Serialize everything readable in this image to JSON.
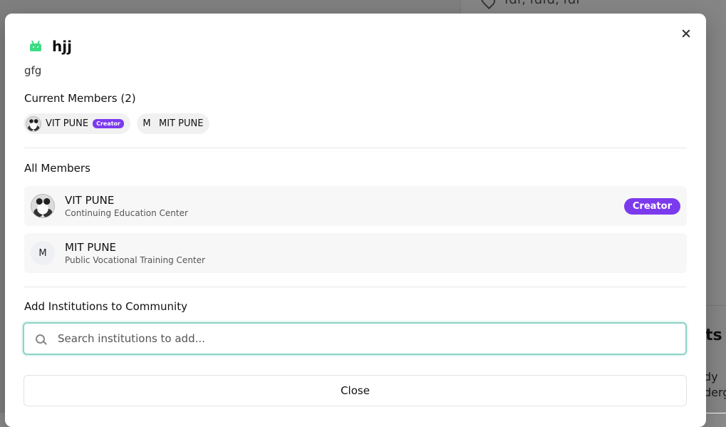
{
  "background": {
    "location_text": "fdf, fdfd, fdf",
    "right_heading": "ts",
    "right_text_1": "dy",
    "right_text_2": "derg"
  },
  "modal": {
    "title": "hjj",
    "description": "gfg",
    "current_members_label": "Current Members (2)",
    "current_members": [
      {
        "name": "VIT PUNE",
        "badge": "Creator",
        "avatar": "panda"
      },
      {
        "name": "MIT PUNE",
        "initial": "M"
      }
    ],
    "all_members_label": "All Members",
    "all_members": [
      {
        "name": "VIT PUNE",
        "type": "Continuing Education Center",
        "badge": "Creator",
        "avatar": "panda"
      },
      {
        "name": "MIT PUNE",
        "type": "Public Vocational Training Center",
        "initial": "M"
      }
    ],
    "add_label": "Add Institutions to Community",
    "search_placeholder": "Search institutions to add...",
    "close_label": "Close"
  }
}
